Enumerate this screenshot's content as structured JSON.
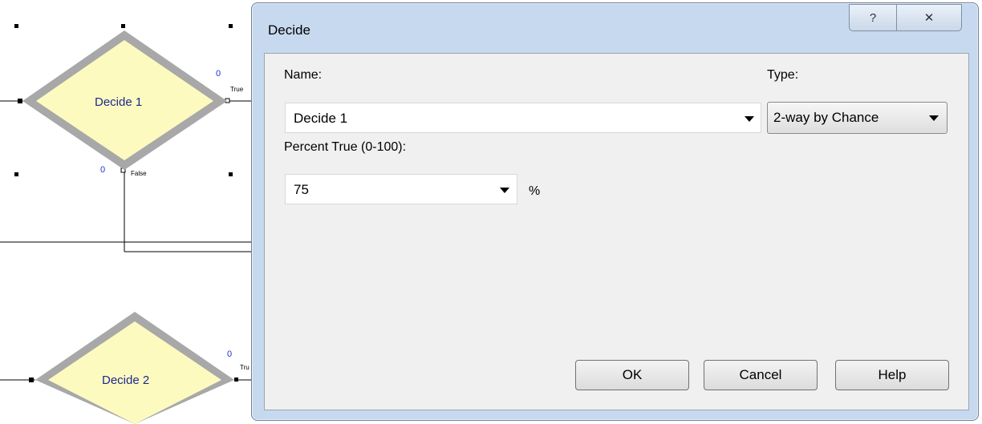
{
  "canvas": {
    "module1": {
      "label": "Decide 1",
      "true_count": "0",
      "true_label": "True",
      "false_count": "0",
      "false_label": "False"
    },
    "module2": {
      "label": "Decide 2",
      "true_count": "0",
      "true_label": "Tru"
    }
  },
  "dialog": {
    "title": "Decide",
    "help_glyph": "?",
    "close_glyph": "✕",
    "name_label": "Name:",
    "name_value": "Decide 1",
    "type_label": "Type:",
    "type_value": "2-way by Chance",
    "percent_label": "Percent True (0-100):",
    "percent_value": "75",
    "percent_unit": "%",
    "ok_label": "OK",
    "cancel_label": "Cancel",
    "help_label": "Help"
  },
  "icons": [
    "help-icon",
    "close-icon",
    "dropdown-arrow-icon"
  ],
  "colors": {
    "module_fill": "#fdfac0",
    "module_border": "#a8a8a8",
    "dialog_frame": "#c7d9ee",
    "client_bg": "#f0f0f0"
  }
}
